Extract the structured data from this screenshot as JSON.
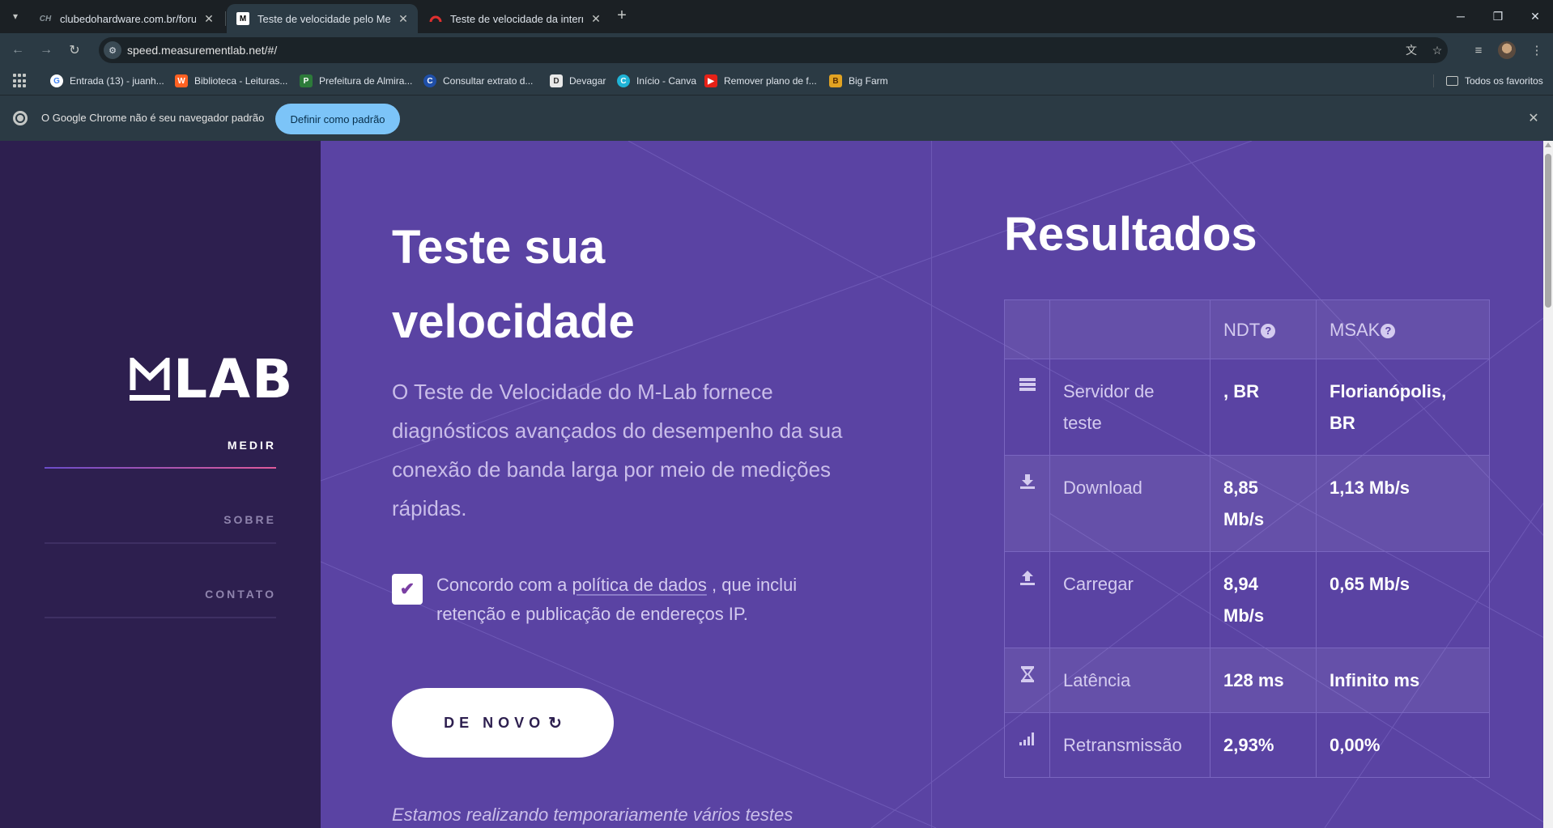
{
  "browser": {
    "tabs": [
      {
        "title": "clubedohardware.com.br/forum",
        "favicon": "clube-do-hardware-icon"
      },
      {
        "title": "Teste de velocidade pelo Measu",
        "favicon": "mlab-icon"
      },
      {
        "title": "Teste de velocidade da internet",
        "favicon": "speedtest-icon"
      }
    ],
    "url": "speed.measurementlab.net/#/",
    "bookmarks": [
      {
        "label": "Entrada (13) - juanh...",
        "icon": "google-icon"
      },
      {
        "label": "Biblioteca - Leituras...",
        "icon": "wattpad-icon"
      },
      {
        "label": "Prefeitura de Almira...",
        "icon": "prefeitura-icon"
      },
      {
        "label": "Consultar extrato d...",
        "icon": "consultar-icon"
      },
      {
        "label": "Devagar",
        "icon": "devagar-icon"
      },
      {
        "label": "Início - Canva",
        "icon": "canva-icon"
      },
      {
        "label": "Remover plano de f...",
        "icon": "youtube-icon"
      },
      {
        "label": "Big Farm",
        "icon": "bigfarm-icon"
      }
    ],
    "all_bookmarks": "Todos os favoritos",
    "infobar": {
      "message": "O Google Chrome não é seu navegador padrão",
      "button": "Definir como padrão"
    }
  },
  "sidebar": {
    "logo": "MLAB",
    "nav": [
      {
        "label": "MEDIR",
        "active": true
      },
      {
        "label": "SOBRE",
        "active": false
      },
      {
        "label": "CONTATO",
        "active": false
      }
    ]
  },
  "main": {
    "title_line1": "Teste sua",
    "title_line2": "velocidade",
    "lead": "O Teste de Velocidade do M-Lab fornece diagnósticos avançados do desempenho da sua conexão de banda larga por meio de medições rápidas.",
    "consent_before": "Concordo com a",
    "consent_link": "política de dados",
    "consent_after": ", que inclui retenção e publicação de endereços IP.",
    "again_button": "DE NOVO",
    "note": "Estamos realizando temporariamente vários testes"
  },
  "results": {
    "title": "Resultados",
    "columns": [
      "NDT",
      "MSAK"
    ],
    "rows": [
      {
        "icon": "server-icon",
        "label": "Servidor de teste",
        "ndt": ", BR",
        "msak": "Florianópolis, BR"
      },
      {
        "icon": "download-icon",
        "label": "Download",
        "ndt": "8,85 Mb/s",
        "msak": "1,13 Mb/s"
      },
      {
        "icon": "upload-icon",
        "label": "Carregar",
        "ndt": "8,94 Mb/s",
        "msak": "0,65 Mb/s"
      },
      {
        "icon": "hourglass-icon",
        "label": "Latência",
        "ndt": "128 ms",
        "msak": "Infinito ms"
      },
      {
        "icon": "signal-bars-icon",
        "label": "Retransmissão",
        "ndt": "2,93%",
        "msak": "0,00%"
      }
    ]
  },
  "colors": {
    "sidebar_bg": "#2d1f4f",
    "main_bg": "#5a43a3",
    "accent_gradient_start": "#6a4cc9",
    "accent_gradient_end": "#e05a9a",
    "infobar_button": "#7cc4f8"
  }
}
